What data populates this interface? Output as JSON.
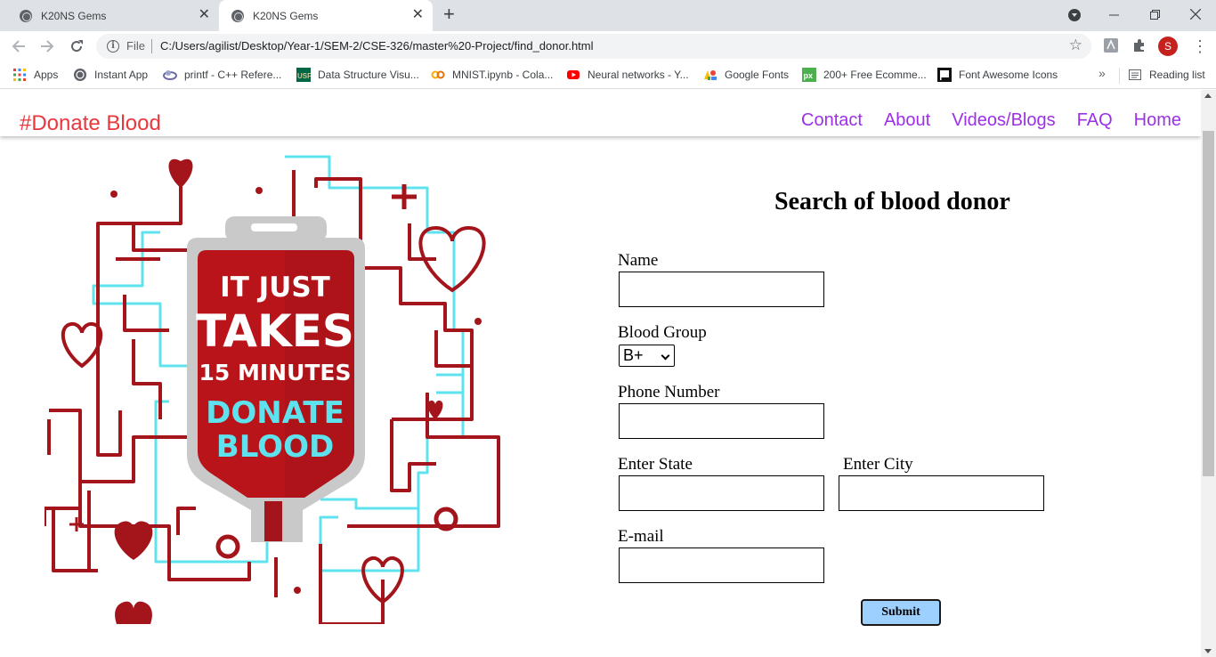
{
  "browser": {
    "tabs": [
      {
        "title": "K20NS Gems",
        "active": false
      },
      {
        "title": "K20NS Gems",
        "active": true
      }
    ],
    "address": {
      "scheme_label": "File",
      "url": "C:/Users/agilist/Desktop/Year-1/SEM-2/CSE-326/master%20-Project/find_donor.html"
    },
    "profile_initial": "S",
    "bookmarks": [
      {
        "label": "Apps",
        "icon": "apps-grid-icon"
      },
      {
        "label": "Instant App",
        "icon": "globe-icon"
      },
      {
        "label": "printf - C++ Refere...",
        "icon": "cplusplus-icon"
      },
      {
        "label": "Data Structure Visu...",
        "icon": "usf-icon"
      },
      {
        "label": "MNIST.ipynb - Cola...",
        "icon": "colab-icon"
      },
      {
        "label": "Neural networks - Y...",
        "icon": "youtube-icon"
      },
      {
        "label": "Google Fonts",
        "icon": "google-fonts-icon"
      },
      {
        "label": "200+ Free Ecomme...",
        "icon": "px-icon"
      },
      {
        "label": "Font Awesome Icons",
        "icon": "flag-icon"
      }
    ],
    "reading_list": "Reading list"
  },
  "site": {
    "brand": "#Donate Blood",
    "nav": [
      "Contact",
      "About",
      "Videos/Blogs",
      "FAQ",
      "Home"
    ]
  },
  "poster": {
    "line1": "IT JUST",
    "line2": "TAKES",
    "line3": "15 MINUTES",
    "line4": "DONATE",
    "line5": "BLOOD"
  },
  "form": {
    "title": "Search of blood donor",
    "name_label": "Name",
    "blood_group_label": "Blood Group",
    "blood_group_value": "B+",
    "phone_label": "Phone Number",
    "state_label": "Enter State",
    "city_label": "Enter City",
    "email_label": "E-mail",
    "submit_label": "Submit"
  },
  "colors": {
    "brand": "#e8383d",
    "nav_link": "#9b30e8",
    "submit_bg": "#9dd0ff",
    "poster_red": "#a3151b",
    "poster_cyan": "#5ee3ee"
  }
}
